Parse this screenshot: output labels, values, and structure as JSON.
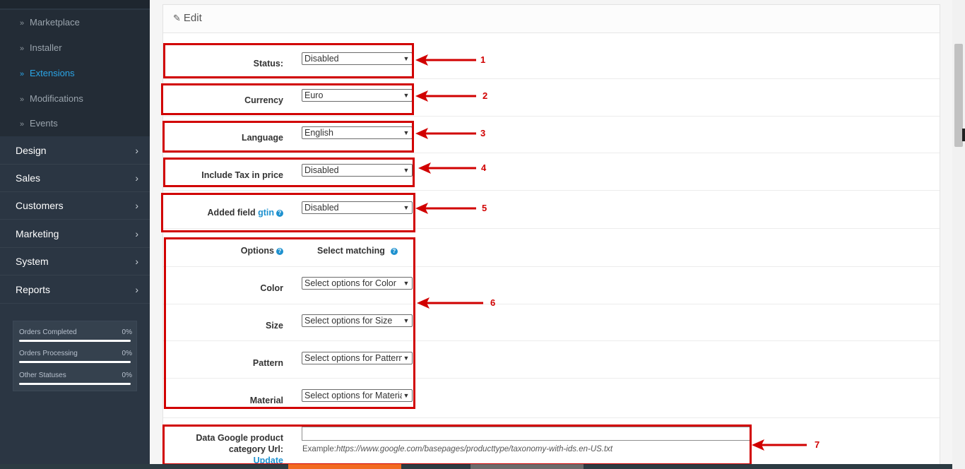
{
  "sidebar": {
    "sub_items": [
      {
        "label": "Marketplace",
        "active": false
      },
      {
        "label": "Installer",
        "active": false
      },
      {
        "label": "Extensions",
        "active": true
      },
      {
        "label": "Modifications",
        "active": false
      },
      {
        "label": "Events",
        "active": false
      }
    ],
    "main_items": [
      {
        "label": "Design"
      },
      {
        "label": "Sales"
      },
      {
        "label": "Customers"
      },
      {
        "label": "Marketing"
      },
      {
        "label": "System"
      },
      {
        "label": "Reports"
      }
    ],
    "stats": [
      {
        "label": "Orders Completed",
        "value": "0%",
        "fraction": 0
      },
      {
        "label": "Orders Processing",
        "value": "0%",
        "fraction": 0
      },
      {
        "label": "Other Statuses",
        "value": "0%",
        "fraction": 0
      }
    ]
  },
  "panel": {
    "heading": "Edit",
    "fields": {
      "status": {
        "label": "Status:",
        "value": "Disabled"
      },
      "currency": {
        "label": "Currency",
        "value": "Euro"
      },
      "language": {
        "label": "Language",
        "value": "English"
      },
      "tax": {
        "label": "Include Tax in price",
        "value": "Disabled"
      },
      "gtin": {
        "label_prefix": "Added field",
        "label_link": "gtin",
        "value": "Disabled"
      }
    },
    "options": {
      "header_options": "Options",
      "header_matching": "Select matching",
      "rows": [
        {
          "label": "Color",
          "value": "Select options for Color"
        },
        {
          "label": "Size",
          "value": "Select options for Size"
        },
        {
          "label": "Pattern",
          "value": "Select options for Pattern"
        },
        {
          "label": "Material",
          "value": "Select options for Material"
        }
      ]
    },
    "category_url": {
      "label_line1": "Data Google product",
      "label_line2": "category Url:",
      "update_link": "Update",
      "textarea_value": "",
      "example_prefix": "Example:",
      "example_url": "https://www.google.com/basepages/producttype/taxonomy-with-ids.en-US.txt"
    }
  },
  "annotations": {
    "numbers": [
      "1",
      "2",
      "3",
      "4",
      "5",
      "6",
      "7"
    ],
    "color": "#d10000"
  },
  "colors": {
    "sidebar_bg": "#2b3643",
    "active_link": "#2ba5e6",
    "link_blue": "#1e91cf",
    "annotation_red": "#d10000"
  }
}
